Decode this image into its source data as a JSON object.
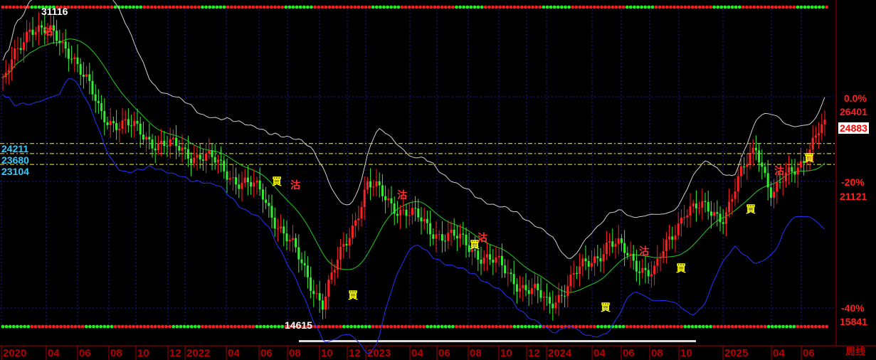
{
  "chart_data": {
    "type": "candlestick",
    "period_label": "周线",
    "y_scale": {
      "top_price": 31116,
      "bottom_price": 14615
    },
    "reference_lines": [
      {
        "value": 24211,
        "label": "24211",
        "color": "#33ccff"
      },
      {
        "value": 23680,
        "label": "23680",
        "color": "#33ccff"
      },
      {
        "value": 23104,
        "label": "23104",
        "color": "#33ccff"
      }
    ],
    "right_axis": [
      {
        "text": "0.0%",
        "value": 26401
      },
      {
        "text": "26401",
        "value": 26401
      },
      {
        "text": "-20%",
        "value": 21121
      },
      {
        "text": "21121",
        "value": 21121
      },
      {
        "text": "-40%",
        "value": 15841
      },
      {
        "text": "15841",
        "value": 15841
      }
    ],
    "last_price": "24883",
    "annotations": {
      "high": "31116",
      "low": "14615"
    },
    "x_labels": [
      "2020",
      "04",
      "06",
      "08",
      "10",
      "12",
      "2022",
      "04",
      "06",
      "08",
      "10",
      "12",
      "2023",
      "04",
      "06",
      "08",
      "10",
      "12",
      "2024",
      "04",
      "06",
      "08",
      "10",
      "2025",
      "04",
      "06"
    ],
    "key_points": [
      {
        "date": "2020-01",
        "close": 27300
      },
      {
        "date": "2020-03",
        "close": 30600
      },
      {
        "date": "2020-06",
        "close": 29100
      },
      {
        "date": "2020-08",
        "close": 25800
      },
      {
        "date": "2020-12",
        "close": 24000
      },
      {
        "date": "2022-02",
        "close": 23600
      },
      {
        "date": "2022-06",
        "close": 21500
      },
      {
        "date": "2022-10",
        "close": 15800
      },
      {
        "date": "2023-01",
        "close": 22000
      },
      {
        "date": "2023-05",
        "close": 19800
      },
      {
        "date": "2023-08",
        "close": 18700
      },
      {
        "date": "2023-12",
        "close": 16300
      },
      {
        "date": "2024-01",
        "close": 15700
      },
      {
        "date": "2024-05",
        "close": 19000
      },
      {
        "date": "2024-08",
        "close": 17300
      },
      {
        "date": "2024-10",
        "close": 20800
      },
      {
        "date": "2025-01",
        "close": 20500
      },
      {
        "date": "2025-03",
        "close": 24200
      },
      {
        "date": "2025-04",
        "close": 21400
      },
      {
        "date": "2025-06",
        "close": 23600
      },
      {
        "date": "2025-07",
        "close": 24883
      }
    ],
    "signals": [
      {
        "text": "沽",
        "color": "#ff3030"
      },
      {
        "text": "買",
        "color": "#ffff00"
      },
      {
        "text": "沽",
        "color": "#ff3030"
      },
      {
        "text": "買",
        "color": "#ffff00"
      },
      {
        "text": "沽",
        "color": "#ff3030"
      },
      {
        "text": "買",
        "color": "#ffff00"
      },
      {
        "text": "沽",
        "color": "#ff3030"
      },
      {
        "text": "買",
        "color": "#ffff00"
      },
      {
        "text": "沽",
        "color": "#ff3030"
      },
      {
        "text": "買",
        "color": "#ffff00"
      },
      {
        "text": "沽",
        "color": "#ff3030"
      },
      {
        "text": "買",
        "color": "#ffff00"
      },
      {
        "text": "買",
        "color": "#ffff00"
      }
    ],
    "colors": {
      "up": "#ff2020",
      "down": "#33ee33",
      "ma": "#22cc22",
      "upper_band": "#d0d0d0",
      "lower_band": "#2233ff",
      "ref_line": "#ffff00"
    }
  }
}
